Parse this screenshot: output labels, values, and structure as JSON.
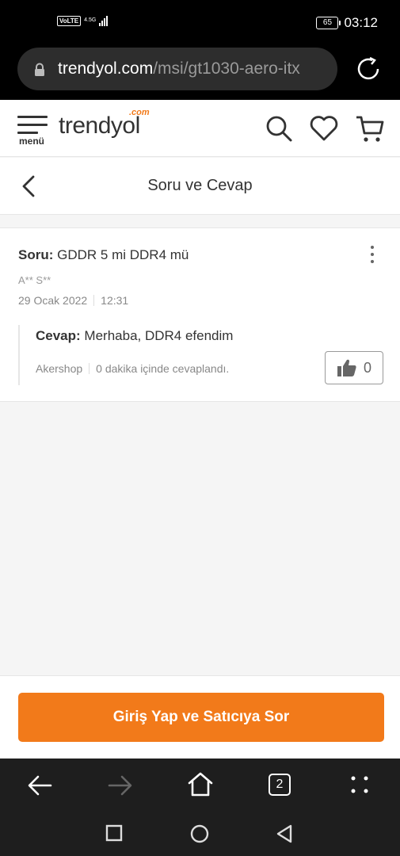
{
  "status_bar": {
    "volte": "VoLTE",
    "network": "4.5G",
    "battery": "65",
    "time": "03:12"
  },
  "browser": {
    "url_domain": "trendyol.com",
    "url_path": "/msi/gt1030-aero-itx",
    "tab_count": "2"
  },
  "site_header": {
    "menu_label": "menü",
    "logo_text": "trendyol",
    "logo_suffix": ".com"
  },
  "page": {
    "title": "Soru ve Cevap"
  },
  "question": {
    "label": "Soru:",
    "text": "GDDR 5 mi DDR4 mü",
    "asker": "A** S**",
    "date": "29 Ocak 2022",
    "time": "12:31"
  },
  "answer": {
    "label": "Cevap:",
    "text": "Merhaba, DDR4 efendim",
    "seller": "Akershop",
    "answered": "0 dakika içinde cevaplandı.",
    "likes": "0"
  },
  "cta": {
    "label": "Giriş Yap ve Satıcıya Sor"
  },
  "colors": {
    "brand": "#f27a1a"
  }
}
